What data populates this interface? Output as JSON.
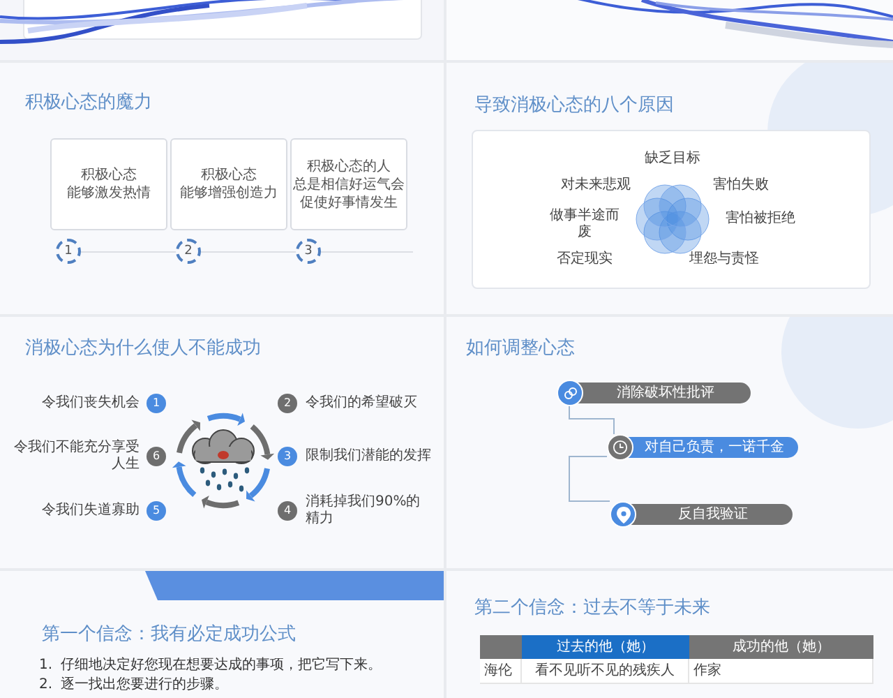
{
  "positive_power": {
    "title": "积极心态的魔力",
    "cards": [
      {
        "number": "1",
        "lines": [
          "积极心态",
          "能够激发热情"
        ]
      },
      {
        "number": "2",
        "lines": [
          "积极心态",
          "能够增强创造力"
        ]
      },
      {
        "number": "3",
        "lines": [
          "积极心态的人",
          "总是相信好运气会",
          "促使好事情发生"
        ]
      }
    ]
  },
  "eight_reasons": {
    "title": "导致消极心态的八个原因",
    "reasons": [
      "缺乏目标",
      "对未来悲观",
      "害怕失败",
      "做事半途而废",
      "害怕被拒绝",
      "否定现实",
      "埋怨与责怪"
    ]
  },
  "why_fail": {
    "title": "消极心态为什么使人不能成功",
    "items": [
      {
        "number": "1",
        "text": "令我们丧失机会",
        "color": "#4a8be0"
      },
      {
        "number": "2",
        "text": "令我们的希望破灭",
        "color": "#6e6e6e"
      },
      {
        "number": "6",
        "text": "令我们不能充分享受人生",
        "color": "#6e6e6e"
      },
      {
        "number": "3",
        "text": "限制我们潜能的发挥",
        "color": "#4a8be0"
      },
      {
        "number": "5",
        "text": "令我们失道寡助",
        "color": "#4a8be0"
      },
      {
        "number": "4",
        "text": "消耗掉我们90%的精力",
        "color": "#6e6e6e"
      }
    ]
  },
  "adjust": {
    "title": "如何调整心态",
    "steps": [
      {
        "label": "消除破坏性批评",
        "color": "#737373",
        "icon": {
          "kind": "link",
          "color": "#4a8be0"
        }
      },
      {
        "label": "对自己负责，一诺千金",
        "color": "#4a8be0",
        "icon": {
          "kind": "clock",
          "color": "#737373"
        }
      },
      {
        "label": "反自我验证",
        "color": "#737373",
        "icon": {
          "kind": "pin",
          "color": "#4a8be0"
        }
      }
    ]
  },
  "belief_one": {
    "title": "第一个信念：我有必定成功公式",
    "items": [
      {
        "number": "1.",
        "text": "仔细地决定好您现在想要达成的事项，把它写下来。"
      },
      {
        "number": "2.",
        "text": "逐一找出您要进行的步骤。"
      }
    ]
  },
  "belief_two": {
    "title": "第二个信念：过去不等于未来",
    "columns": [
      {
        "color": "#757575"
      },
      {
        "label": "过去的他（她）",
        "color": "#1b6fc6"
      },
      {
        "label": "成功的他（她）",
        "color": "#757575"
      }
    ],
    "rows": [
      [
        "海伦",
        "看不见听不见的残疾人",
        "作家"
      ]
    ]
  }
}
